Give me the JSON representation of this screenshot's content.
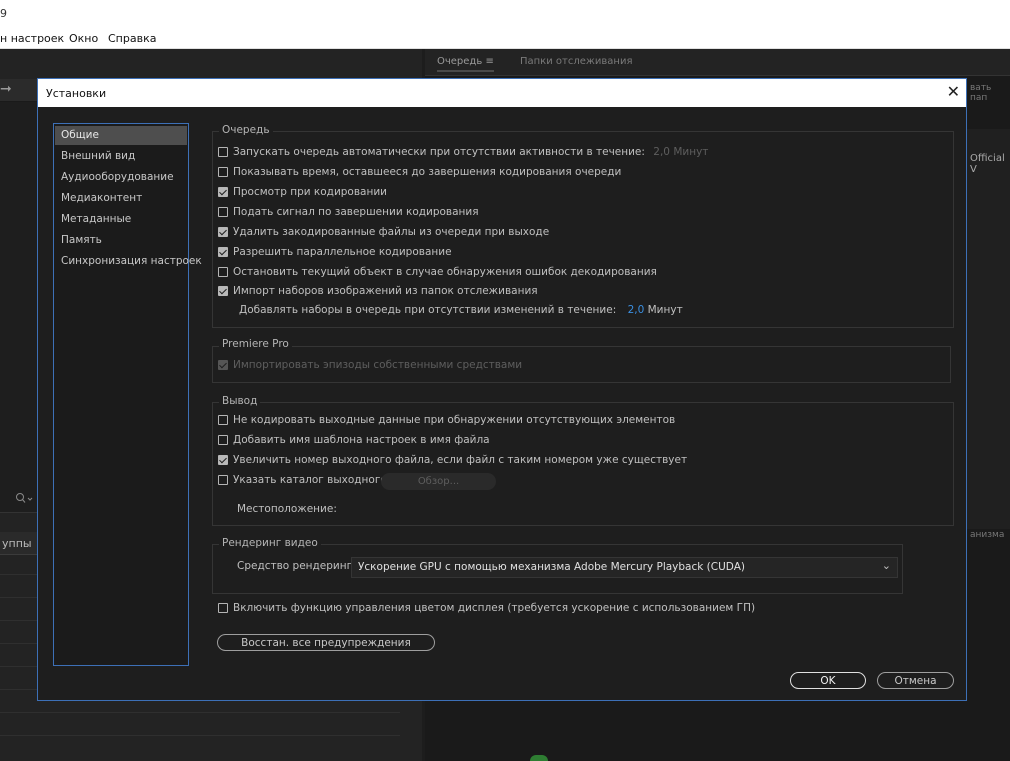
{
  "app": {
    "title_fragment": "9",
    "menu": [
      "н настроек",
      "Окно",
      "Справка"
    ],
    "right_tabs": [
      "Очередь",
      "Папки отслеживания"
    ],
    "right_peek": [
      "вать пап",
      "Official V",
      "анизма"
    ],
    "left_groups_label": "уппы"
  },
  "dialog": {
    "title": "Установки",
    "close_glyph": "✕",
    "nav": [
      "Общие",
      "Внешний вид",
      "Аудиооборудование",
      "Медиаконтент",
      "Метаданные",
      "Память",
      "Синхронизация настроек"
    ],
    "nav_selected": 0,
    "queue": {
      "title": "Очередь",
      "auto_start": {
        "label": "Запускать очередь автоматически при отсутствии активности в течение:",
        "value": "2,0",
        "unit": "Минут",
        "checked": false
      },
      "show_time": {
        "label": "Показывать время, оставшееся до завершения кодирования очереди",
        "checked": false
      },
      "preview": {
        "label": "Просмотр при кодировании",
        "checked": true
      },
      "signal": {
        "label": "Подать сигнал по завершении кодирования",
        "checked": false
      },
      "remove_encoded": {
        "label": "Удалить закодированные файлы из очереди при выходе",
        "checked": true
      },
      "parallel": {
        "label": "Разрешить параллельное кодирование",
        "checked": true
      },
      "stop_on_error": {
        "label": "Остановить текущий объект в случае обнаружения ошибок декодирования",
        "checked": false
      },
      "import_sets": {
        "label": "Импорт наборов изображений из папок отслеживания",
        "checked": true
      },
      "add_sets": {
        "label": "Добавлять наборы в очередь при отсутствии изменений в течение:",
        "value": "2,0",
        "unit": "Минут"
      }
    },
    "premiere": {
      "title": "Premiere Pro",
      "native_import": {
        "label": "Импортировать эпизоды собственными средствами",
        "checked": true
      }
    },
    "output": {
      "title": "Вывод",
      "no_encode_missing": {
        "label": "Не кодировать выходные данные при обнаружении отсутствующих элементов",
        "checked": false
      },
      "add_preset_name": {
        "label": "Добавить имя шаблона настроек в имя файла",
        "checked": false
      },
      "increment_number": {
        "label": "Увеличить номер выходного файла, если файл с таким номером уже существует",
        "checked": true
      },
      "specify_dir": {
        "label": "Указать каталог выходного файла:",
        "checked": false
      },
      "browse_label": "Обзор...",
      "location_label": "Местоположение:"
    },
    "render": {
      "title": "Рендеринг видео",
      "renderer_label": "Средство рендеринга:",
      "renderer_value": "Ускорение GPU с помощью механизма Adobe Mercury Playback (CUDA)",
      "chevron": "⌄"
    },
    "color_mgmt": {
      "label": "Включить функцию управления цветом дисплея  (требуется ускорение с использованием ГП)",
      "checked": false
    },
    "reset_warnings": "Восстан. все предупреждения",
    "ok": "OK",
    "cancel": "Отмена"
  }
}
